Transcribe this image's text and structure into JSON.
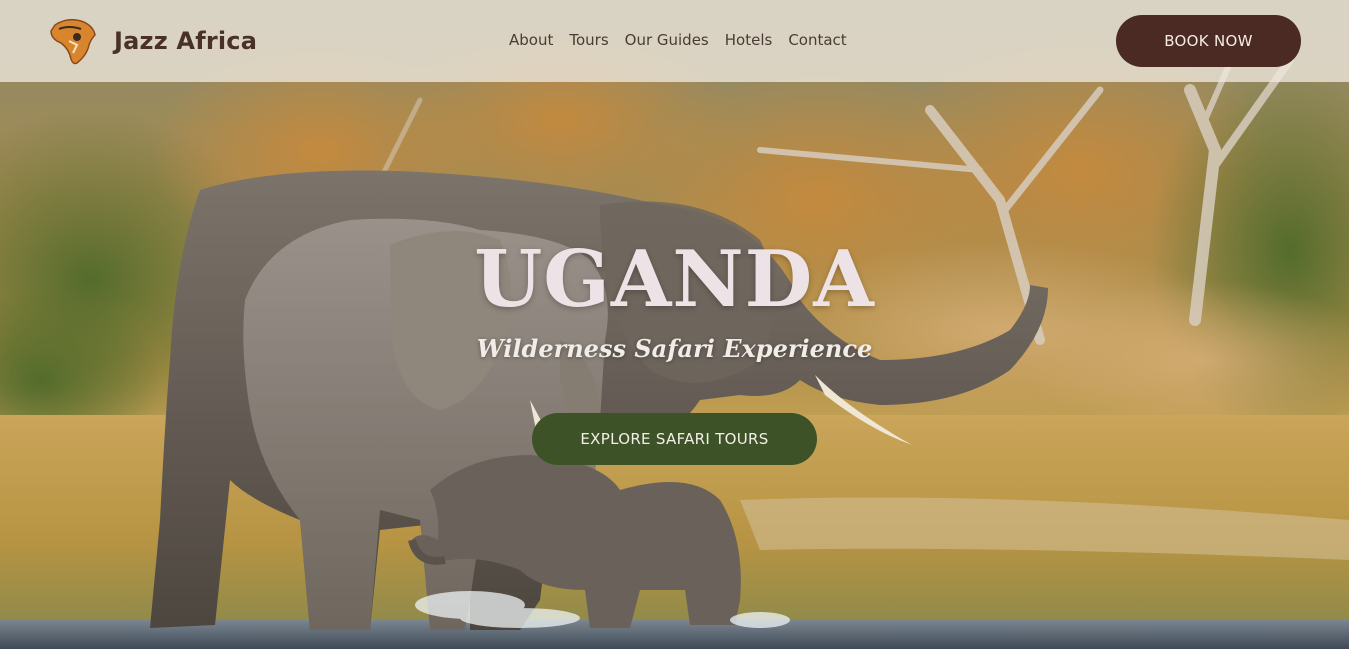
{
  "brand": {
    "name": "Jazz Africa",
    "logo_icon": "africa-map-logo-icon"
  },
  "nav": {
    "items": [
      "About",
      "Tours",
      "Our Guides",
      "Hotels",
      "Contact"
    ]
  },
  "header": {
    "book_label": "BOOK NOW"
  },
  "hero": {
    "title": "UGANDA",
    "subtitle": "Wilderness Safari Experience",
    "cta_label": "EXPLORE SAFARI TOURS"
  },
  "colors": {
    "primary_button": "#4a2a22",
    "cta_button": "#3e5228",
    "brand_text": "#4a3128",
    "header_bg": "#eee8de"
  }
}
